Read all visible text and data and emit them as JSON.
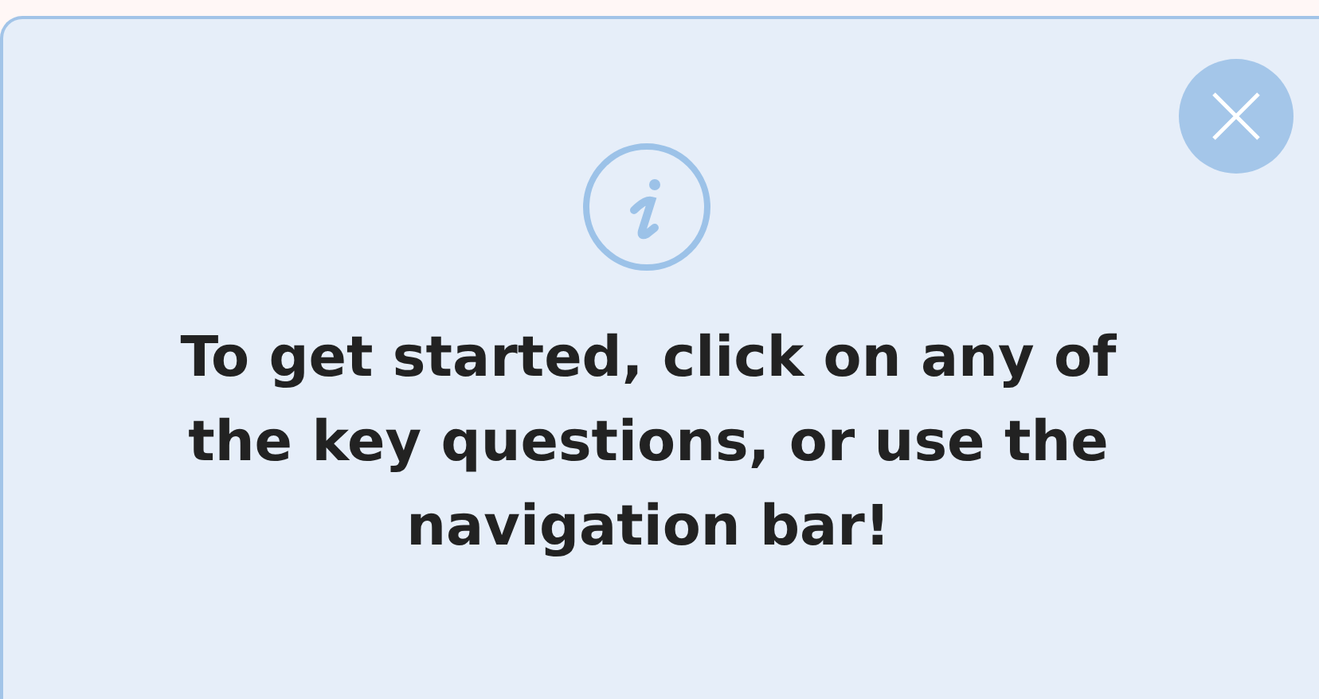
{
  "dialog": {
    "message": "To get started, click on any of the key questions, or use the navigation bar!"
  }
}
